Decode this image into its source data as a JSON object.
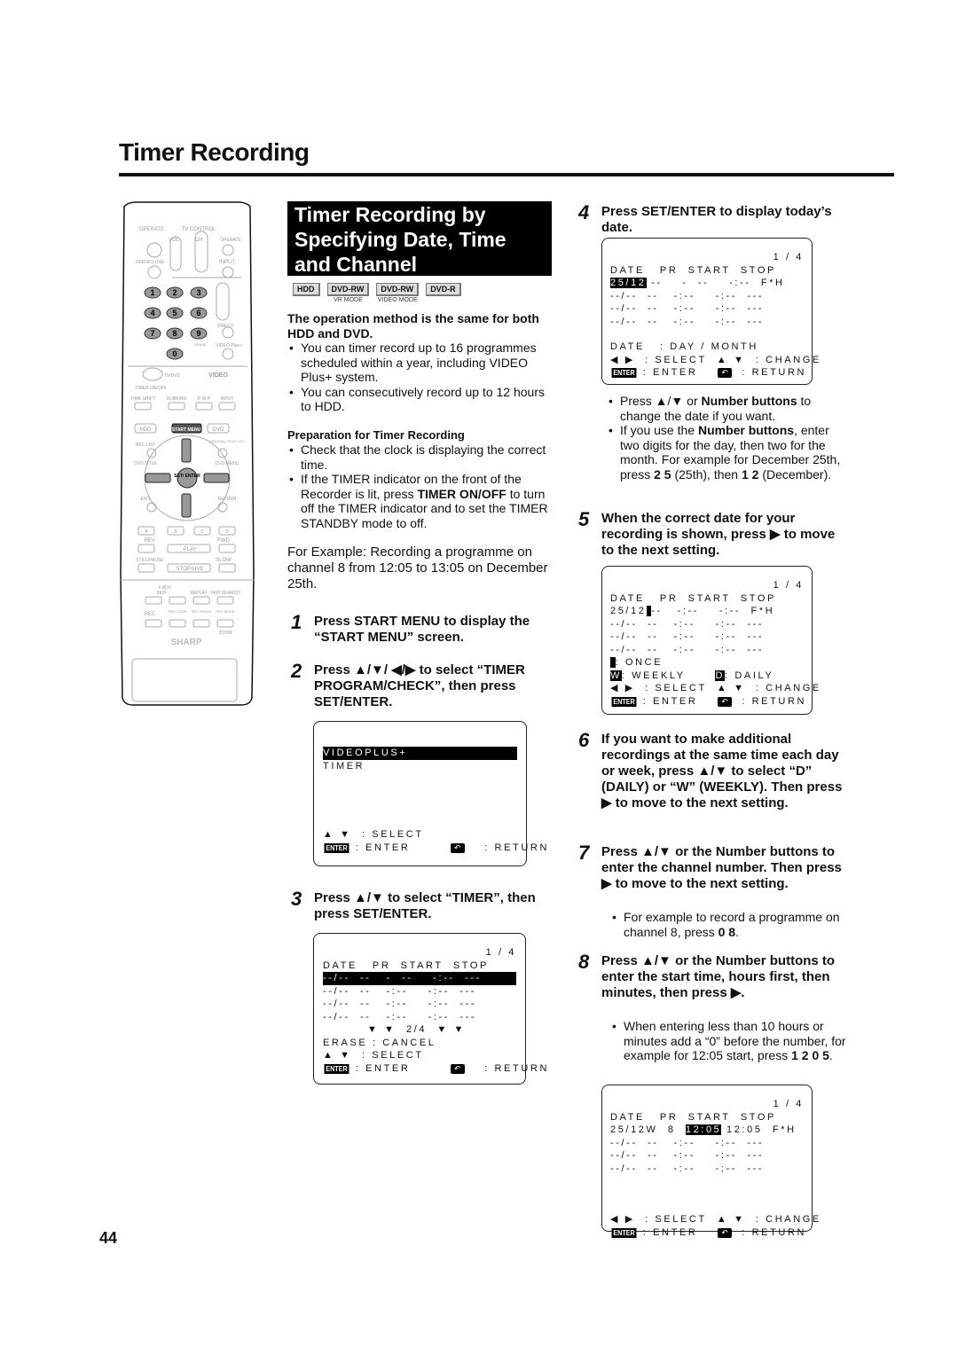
{
  "page": {
    "title": "Timer Recording",
    "page_number": "44"
  },
  "remote": {
    "labels": {
      "operate": "OPERATE",
      "tv_control": "TV CONTROL",
      "vol": "VOL",
      "ch": "CH",
      "tv_operate": "OPERATE",
      "open_close": "OPEN/CLOSE",
      "input": "INPUT",
      "direct": "DIRECT",
      "erase": "ERASE",
      "video_plus": "VIDEO Plus+",
      "tv_dvd": "TV/DVD",
      "videoplus_logo": "VIDEO",
      "timer_on_off": "TIMER ON/OFF",
      "time_shift": "TIME SHIFT",
      "dubbing": "DUBBING",
      "pinp": "P IN P",
      "hdd": "HDD",
      "start_menu": "START MENU",
      "dvd": "DVD",
      "rec_list": "REC LIST",
      "original_playlist": "ORIGINAL/ PLAY LIST",
      "dvd_title": "DVD TITLE",
      "dvd_menu": "DVD MENU",
      "set_enter": "SET/ ENTER",
      "exit": "EXIT",
      "return": "RETURN",
      "a": "A",
      "b": "B",
      "c": "C",
      "d": "D",
      "rev": "REV",
      "fwd": "FWD",
      "play": "PLAY",
      "still_pause": "STILL/PAUSE",
      "slow": "SLOW",
      "stop_live": "STOP/LIVE",
      "fadv": "F.ADV",
      "skip": "SKIP",
      "replay": "REPLAY",
      "skip_search": "SKIP SEARCH",
      "rec": "REC",
      "rec_stop": "REC STOP",
      "rec_pause": "REC PAUSE",
      "rec_mode": "REC MODE",
      "zoom": "ZOOM",
      "brand": "SHARP"
    },
    "number_keys": [
      "1",
      "2",
      "3",
      "4",
      "5",
      "6",
      "7",
      "8",
      "9",
      "0"
    ],
    "minus_key": "-/--",
    "clear_key": "C"
  },
  "section": {
    "heading_lines": [
      "Timer Recording by",
      "Specifying Date, Time",
      "and Channel"
    ],
    "badges": [
      {
        "label": "HDD",
        "sub": ""
      },
      {
        "label": "DVD-RW",
        "sub": "VR MODE"
      },
      {
        "label": "DVD-RW",
        "sub": "VIDEO MODE"
      },
      {
        "label": "DVD-R",
        "sub": ""
      }
    ],
    "note_heading": "The operation method is the same for both HDD and DVD.",
    "notes": [
      "You can timer record up to 16 programmes scheduled within a year, including VIDEO Plus+ system.",
      "You can consecutively record up to 12 hours to HDD."
    ],
    "prep_heading": "Preparation for Timer Recording",
    "prep_items": [
      "Check that the clock is displaying the correct time.",
      {
        "pre": "If the TIMER indicator on the front of the Recorder is lit, press ",
        "bold": "TIMER ON/OFF",
        "post": " to turn off the TIMER indicator and to set the TIMER STANDBY mode to off."
      }
    ],
    "example": "For Example: Recording a programme on channel 8 from 12:05 to 13:05 on December 25th."
  },
  "steps": [
    {
      "num": "1",
      "html": "Press <b class='k'>START MENU</b> to display the “START MENU” screen."
    },
    {
      "num": "2",
      "html": "Press ▲/▼/ ◀/▶ to select “TIMER PROGRAM/CHECK”, then press <b class='k'>SET/ENTER</b>."
    },
    {
      "num": "3",
      "html": "Press ▲/▼ to select “TIMER”, then press <b class='k'>SET/ENTER</b>."
    },
    {
      "num": "4",
      "html": "Press <b class='k'>SET/ENTER</b> to display today’s date."
    },
    {
      "num": "5",
      "html": "When the correct date for your recording is shown, press ▶ to move to the next setting."
    },
    {
      "num": "6",
      "html": "If you want to make additional recordings at the same time each day or week, press ▲/▼ to select “D” (DAILY) or “W” (WEEKLY). Then press ▶ to move to the next setting."
    },
    {
      "num": "7",
      "html": "Press ▲/▼ or the <b class='k'>Number</b> buttons to enter the channel number. Then press ▶ to move to the next setting."
    },
    {
      "num": "8",
      "html": "Press ▲/▼ or the <b class='k'>Number</b> buttons to enter the start time, hours first, then minutes, then press ▶."
    }
  ],
  "step_notes": {
    "step4": [
      "Press ▲/▼ or <b>Number buttons</b> to change the date if you want.",
      "If you use the <b>Number buttons</b>, enter two digits for the day, then two for the month. For example for December 25th, press <b>2 5</b> (25th), then <b>1 2</b> (December)."
    ],
    "step7": [
      "For example to record a programme on channel 8, press <b>0 8</b>."
    ],
    "step8": [
      "When entering less than 10 hours or minutes add a “0” before the number, for example for 12:05 start, press <b>1 2 0 5</b>."
    ]
  },
  "screens": {
    "start_menu": {
      "items": [
        "VIDEOPLUS+",
        "TIMER"
      ],
      "selected": 0,
      "hints": {
        "select": ": SELECT",
        "enter": ": ENTER",
        "return": ": RETURN"
      }
    },
    "timer_list": {
      "page": "1 / 4",
      "header": "DATE   PR  START  STOP",
      "rows": [
        "--/--  --   -  --    -:--  ---",
        "--/--  --   -:--    -:--  ---",
        "--/--  --   -:--    -:--  ---",
        "--/--  --   -:--    -:--  ---"
      ],
      "pager": "▼ ▼  2/4  ▼ ▼",
      "erase": "ERASE : CANCEL",
      "hints": {
        "select": ": SELECT",
        "enter": ": ENTER",
        "return": ": RETURN"
      }
    },
    "date_entry": {
      "page": "1 / 4",
      "header": "DATE   PR  START  STOP",
      "first_row": {
        "date": "25/12",
        "rest": " --    -  --    -:--  F*H"
      },
      "rows": [
        "--/--  --   -:--    -:--  ---",
        "--/--  --   -:--    -:--  ---",
        "--/--  --   -:--    -:--  ---"
      ],
      "date_hint": "DATE   : DAY / MONTH",
      "hints": {
        "select": ": SELECT",
        "change": ": CHANGE",
        "enter": ": ENTER",
        "return": ": RETURN"
      }
    },
    "mode_entry": {
      "page": "1 / 4",
      "header": "DATE   PR  START  STOP",
      "first_row": {
        "date": "25/12",
        "rest": "--   -:--    -:--  F*H"
      },
      "rows": [
        "--/--  --   -:--    -:--  ---",
        "--/--  --   -:--    -:--  ---",
        "--/--  --   -:--    -:--  ---"
      ],
      "once": ": ONCE",
      "weekly_key": "W",
      "weekly": ": WEEKLY",
      "daily_key": "D",
      "daily": ": DAILY",
      "hints": {
        "select": ": SELECT",
        "change": ": CHANGE",
        "enter": ": ENTER",
        "return": ": RETURN"
      }
    },
    "time_entry": {
      "page": "1 / 4",
      "header": "DATE   PR  START  STOP",
      "first_row": {
        "date": "25/12W  8",
        "start": "12:05",
        "rest": " 12:05  F*H"
      },
      "rows": [
        "--/--  --   -:--    -:--  ---",
        "--/--  --   -:--    -:--  ---",
        "--/--  --   -:--    -:--  ---"
      ],
      "hints": {
        "select": ": SELECT",
        "change": ": CHANGE",
        "enter": ": ENTER",
        "return": ": RETURN"
      }
    },
    "key_labels": {
      "enter": "ENTER",
      "return": "↶"
    }
  }
}
